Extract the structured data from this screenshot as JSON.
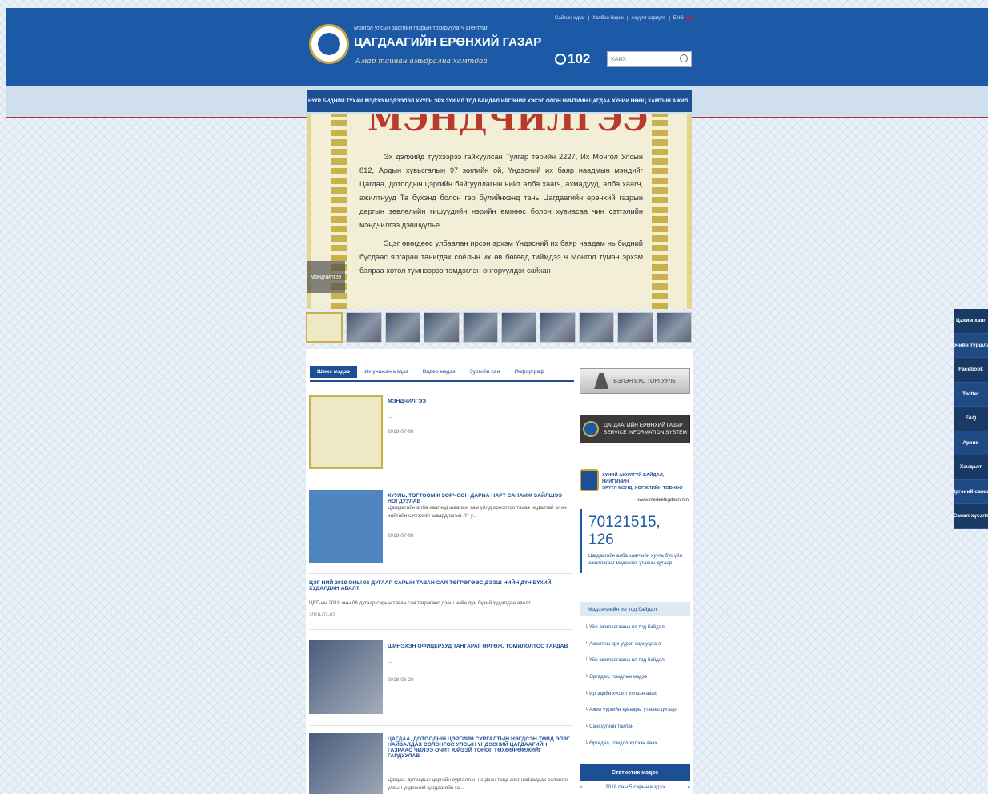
{
  "header": {
    "org_line1": "Монгол улсын засгийн газрын тохируулагч агентлаг",
    "org_name": "ЦАГДААГИЙН ЕРӨНХИЙ ГАЗАР",
    "slogan": "Амар тайван амьдрална хамтдаа",
    "top_links": [
      "Сайтын зураг",
      "Холбоо барих",
      "Асуулт хариулт",
      "ENG"
    ],
    "hotline": "102",
    "search_placeholder": "ХАЙХ"
  },
  "nav": {
    "items": [
      "НҮҮР",
      "БИДНИЙ ТУХАЙ",
      "МЭДЭЭ МЭДЭЭЛЭЛ",
      "ХУУЛЬ ЭРХ ЗҮЙ",
      "ИЛ ТОД БАЙДАЛ",
      "ИРГЭНИЙ ХЭСЭГ",
      "ОЛОН НИЙТИЙН ЦАГДАА",
      "ХҮНИЙ НӨӨЦ",
      "ХАМТЫН АЖИЛ"
    ]
  },
  "banner": {
    "title": "МЭНДЧИЛГЭЭ",
    "paragraph1": "Эх дэлхийд түүхээрээ гайхуулсан Тулгар төрийн 2227, Их Монгол Улсын 812, Ардын хувьсгалын 97 жилийн ой, Үндэсний их баяр наадмын мэндийг Цагдаа, дотоодын цэргийн байгууллагын нийт алба хаагч, ахмадууд, алба хаагч, ажилтнууд Та бүхэнд болон гэр бүлийнхэнд тань Цагдаагийн ерөнхий газрын даргын зөвлөлийн гишүүдийн нэрийн өмнөөс болон хувиасаа чин сэтгэлийн мэндчилгээ дэвшүүлье.",
    "paragraph2": "Эцэг өвөгдөөс улбаалан ирсэн эрхэм Үндэсний их баяр наадам нь бидний бүсдаас ялгаран танигдах соёлын их өв бөгөөд тиймдээ ч Монгол түмэн эрхэм баяраа хотол түмнээрээ тэмдэглэн өнгөрүүлдэг сайхан",
    "label": "Мэндчилгээ"
  },
  "tabs": [
    "Шинэ мэдээ",
    "Их уншсан мэдээ",
    "Видео мэдээ",
    "Зургийн сан",
    "Инфорграф"
  ],
  "news": [
    {
      "title": "МЭНДЧИЛГЭЭ",
      "body": "...",
      "date": "2018-07-08"
    },
    {
      "title": "ХУУЛЬ, ТОГТООМЖ ЗӨРЧСӨН ДАРИА НАРТ САНАМЖ ЗАЙЛШЭЭ НОГДУУЛАВ",
      "body": "Цагдаагийн алба хаагчид шаалын зам үйлд ороолтоо тасаа чадалтай олон нийтийн сэтгэхийг шаардлагын. Үг у...",
      "date": "2018-07-08"
    },
    {
      "title": "ЦЭГ НИЙ 2018 ОНЫ 06 ДУГААР САРЫН ТАВАН САЯ ТӨГРӨГӨӨС ДЭЭШ НИЙН ДҮН БҮХИЙ ХУДАЛДАН АВАЛТ",
      "body": "ЦЕГ-ын 2018 оны 06 дугаар сарын таван сая төгрөгөөс дээш нийн дүн бүхий худалдан авалт...",
      "date": "2018-07-02"
    },
    {
      "title": "ШИНЭХЭН ОФИЦЕРУУД ТАНГАРАГ ӨРГӨЖ, ТОМИЛОЛТОО ГАРДАВ",
      "body": "...",
      "date": "2018-06-28"
    },
    {
      "title": "ЦАГДАА, ДОТООДЫН ЦЭРГИЙН СУРГАЛТЫН НЭГДСЭН ТӨВД ЭЛЭГ НАЙЗАЛДАХ СОЛОНГОС УЛСЫН ҮНДЭСНИЙ ЦАГДААГИЙН ГАЗРААС ЧИЛЭЭ ОЧИТ ЮЙЗЭЙ ТОНОГ ТӨХӨӨРӨМЖИЙГ ГАРДУУЛАВ",
      "body": "Цагдаа, дотоодын цэргийн сургалтын нэгдсэн төвд элэг найзалдах солонгос улсын үндэсний цагдаагийн га..."
    }
  ],
  "sidebar": {
    "corruption_btn": "БЭЛЭН БУС ТОРГУУЛЬ",
    "service_btn_line1": "ЦАГДААГИЙН ЕРӨНХИЙ ГАЗАР",
    "service_btn_line2": "SERVICE INFORMATION SYSTEM",
    "mongol_line1": "ХҮНИЙ АЮУЛГҮЙ БАЙДАЛ, НИЙГМИЙН",
    "mongol_line2": "ЭРҮҮЛ МЭНД, ХӨГЖЛИЙН ТОВЧОО",
    "mongol_url": "www.medeelegdsen.mn",
    "phone": "70121515, 126",
    "phone_desc": "Цагдаагийн алба хаагчийн хууль бус үйл ажиллагааг мэдээлэх утасны дугаар",
    "regulation_title": "Мэдээллийн ил тод байдал",
    "regulation_items": [
      "Үйл ажиллагааны ил тод байдал",
      "Ажилтны эрх үүрэг, хариуцлага",
      "Үйл ажиллагааны ил тод байдал",
      "Өргөдөл, гомдлын мэдээ",
      "Иргэдийн хүсэлт хүлээн авах",
      "Ажил үүргийн хуваарь, утасны дугаар",
      "Санхүүгийн тайлан",
      "Өргөдөл, гомдол хүлээн авах"
    ],
    "stat_title": "Статистик мэдээ",
    "stat_prev": "«",
    "stat_period": "2018 оны 5 сарын мэдээ",
    "stat_next": "»"
  },
  "right_bar": [
    "Цахим хаяг",
    "Гэрчийн туршлага",
    "Facebook",
    "Twitter",
    "FAQ",
    "Архив",
    "Хандалт",
    "Иргэний санал",
    "Санал хүсэлт"
  ]
}
